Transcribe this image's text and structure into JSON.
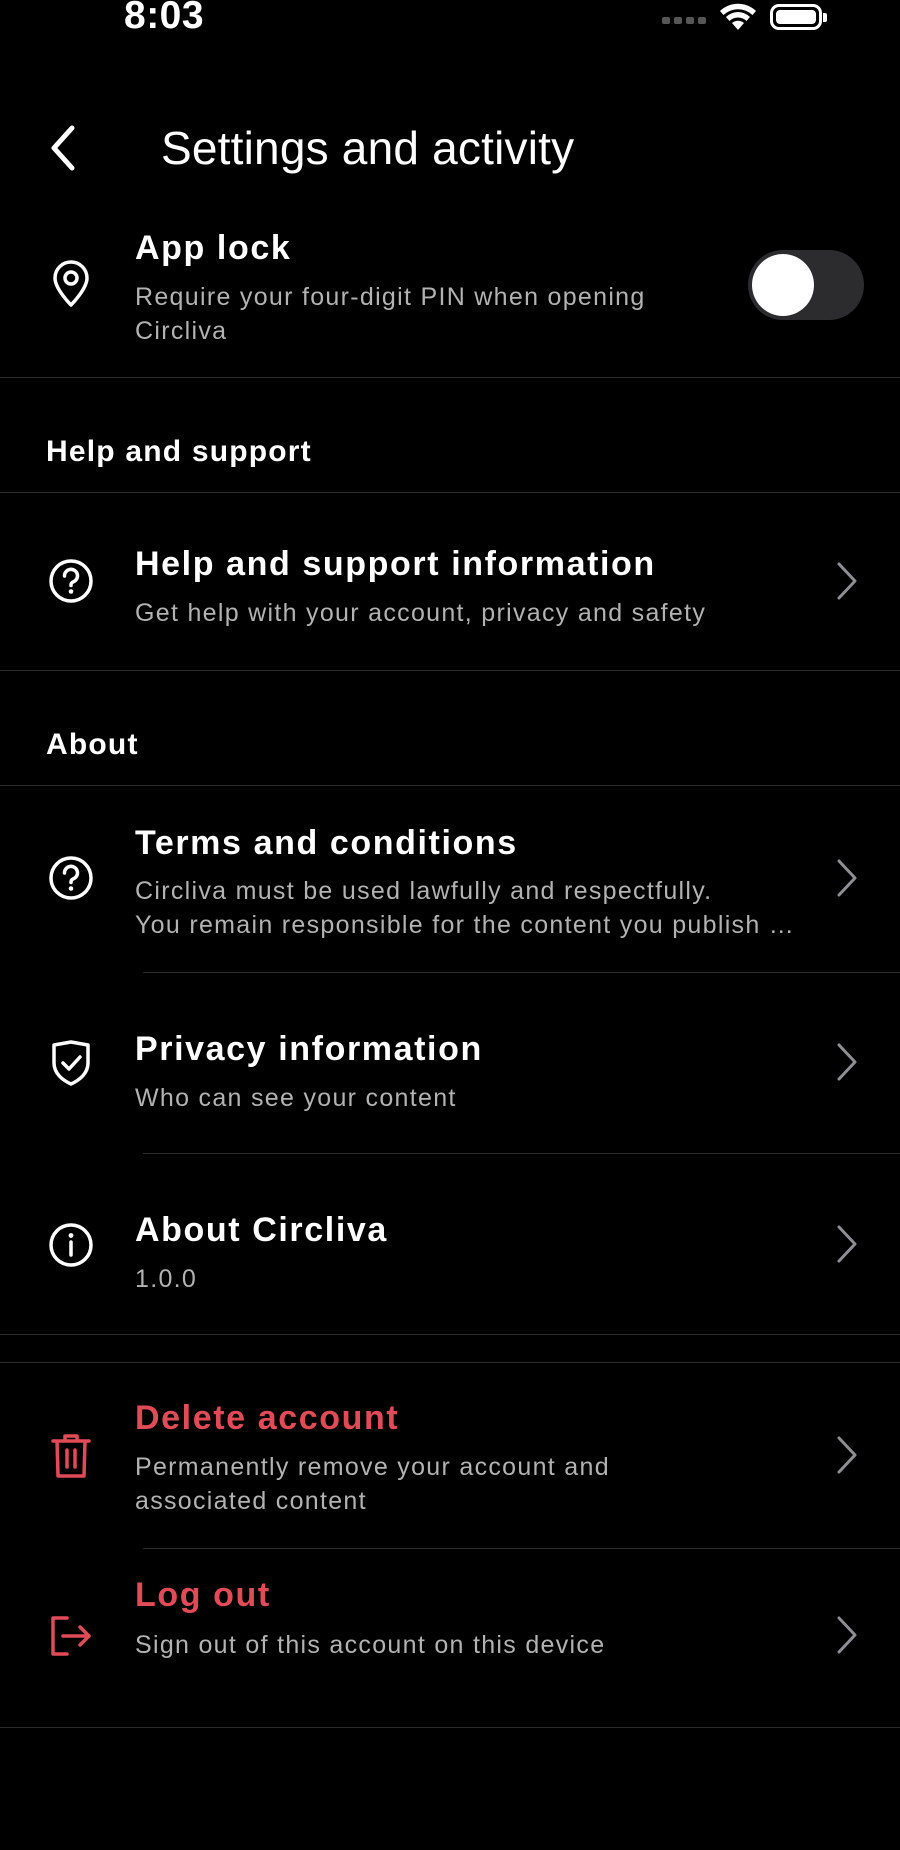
{
  "status_bar": {
    "time": "8:03",
    "icons": [
      "signal-icon",
      "wifi-icon",
      "battery-icon"
    ]
  },
  "header": {
    "back_icon": "chevron-left-icon",
    "title": "Settings and activity"
  },
  "app_lock": {
    "icon": "location-pin-icon",
    "title": "App lock",
    "subtitle": "Require your four-digit PIN when opening Circliva",
    "toggle_on": false
  },
  "sections": {
    "help": "Help and support",
    "about": "About"
  },
  "help_items": [
    {
      "icon": "question-circle-icon",
      "title": "Help and support information",
      "subtitle": "Get help with your account, privacy and safety"
    }
  ],
  "about_items": [
    {
      "icon": "question-circle-icon",
      "title": "Terms and conditions",
      "subtitle_line1": "Circliva must be used lawfully and respectfully.",
      "subtitle_line2": "You remain responsible for the content you publish and the actions you take."
    },
    {
      "icon": "shield-check-icon",
      "title": "Privacy information",
      "subtitle": "Who can see your content"
    },
    {
      "icon": "info-circle-icon",
      "title": "About Circliva",
      "subtitle": "1.0.0"
    }
  ],
  "account_items": [
    {
      "icon": "trash-icon",
      "title": "Delete account",
      "subtitle": "Permanently remove your account and associated content"
    },
    {
      "icon": "logout-icon",
      "title": "Log out",
      "subtitle": "Sign out of this account on this device"
    }
  ],
  "colors": {
    "background": "#000000",
    "text_primary": "#ffffff",
    "text_secondary": "#b2b2b2",
    "danger": "#e04b57",
    "divider": "#2c2c2e"
  }
}
